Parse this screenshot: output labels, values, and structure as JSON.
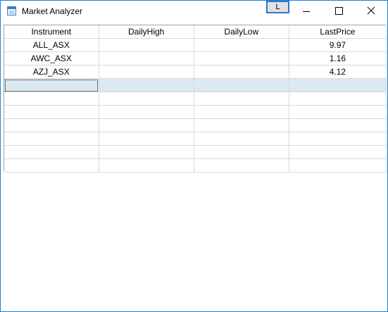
{
  "window": {
    "title": "Market Analyzer",
    "l_button_label": "L",
    "accent_color": "#1883d7"
  },
  "grid": {
    "columns": [
      "Instrument",
      "DailyHigh",
      "DailyLow",
      "LastPrice"
    ],
    "rows": [
      [
        "ALL_ASX",
        "",
        "",
        "9.97"
      ],
      [
        "AWC_ASX",
        "",
        "",
        "1.16"
      ],
      [
        "AZJ_ASX",
        "",
        "",
        "4.12"
      ],
      [
        "",
        "",
        "",
        ""
      ],
      [
        "",
        "",
        "",
        ""
      ],
      [
        "",
        "",
        "",
        ""
      ],
      [
        "",
        "",
        "",
        ""
      ],
      [
        "",
        "",
        "",
        ""
      ],
      [
        "",
        "",
        "",
        ""
      ],
      [
        "",
        "",
        "",
        ""
      ]
    ],
    "selected_row_index": 3,
    "selected_row_color": "#dbeaf2"
  }
}
